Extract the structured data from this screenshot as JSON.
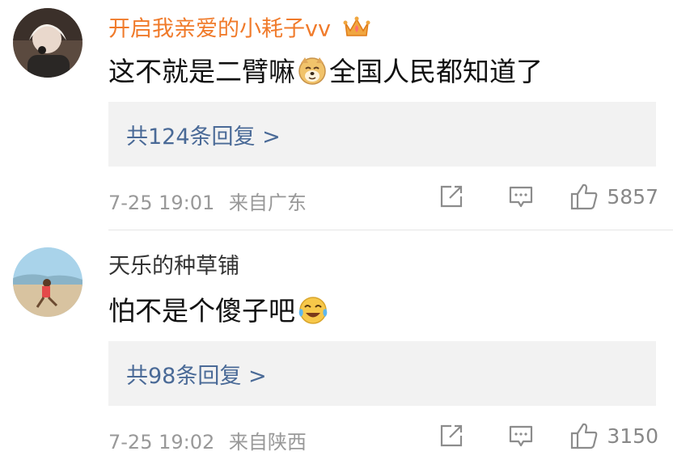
{
  "comments": [
    {
      "username": "开启我亲爱的小耗子vv",
      "username_color": "#f07a2a",
      "avatar_icon": "user-avatar-1",
      "badge_icon": "crown-icon",
      "text_before": "这不就是二臂嘛",
      "emoji": "doge-emoji",
      "text_after": "全国人民都知道了",
      "replies": "共124条回复 >",
      "time": "7-25 19:01",
      "location": "来自广东",
      "likes": "5857"
    },
    {
      "username": "天乐的种草铺",
      "username_color": "#333333",
      "avatar_icon": "user-avatar-2",
      "text_before": "怕不是个傻子吧",
      "emoji": "laugh-cry-emoji",
      "text_after": "",
      "replies": "共98条回复 >",
      "time": "7-25 19:02",
      "location": "来自陕西",
      "likes": "3150"
    }
  ]
}
